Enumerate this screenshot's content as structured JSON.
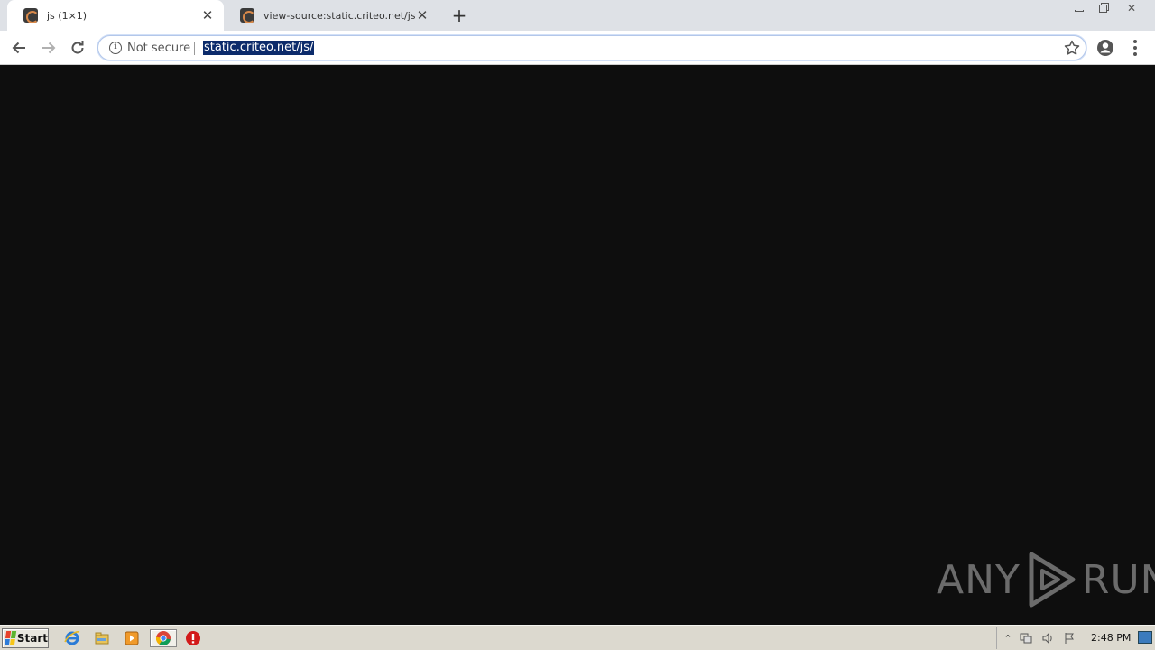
{
  "tabs": [
    {
      "title": "js (1×1)",
      "active": true
    },
    {
      "title": "view-source:static.criteo.net/js/ld/p",
      "active": false
    }
  ],
  "toolbar": {
    "security_label": "Not secure",
    "url": "static.criteo.net/js/"
  },
  "watermark": {
    "left": "ANY",
    "right": "RUN"
  },
  "taskbar": {
    "start_label": "Start",
    "clock": "2:48 PM"
  },
  "colors": {
    "content_bg": "#0e0e0e",
    "tabstrip_bg": "#dee1e6",
    "url_highlight": "#0c2b6b",
    "taskbar_bg": "#dcd9cf"
  }
}
